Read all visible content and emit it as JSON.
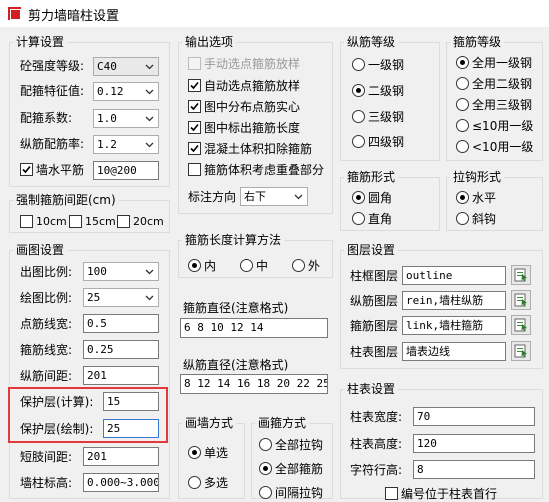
{
  "window": {
    "title": "剪力墙暗柱设置"
  },
  "calc": {
    "legend": "计算设置",
    "concrete_label": "砼强度等级:",
    "concrete_value": "C40",
    "stirrup_char_label": "配箍特征值:",
    "stirrup_char_value": "0.12",
    "stirrup_coef_label": "配箍系数:",
    "stirrup_coef_value": "1.0",
    "longit_ratio_label": "纵筋配筋率:",
    "longit_ratio_value": "1.2",
    "wall_hrebar_label": "墙水平筋",
    "wall_hrebar_value": "10@200",
    "wall_hrebar_checked": true
  },
  "forced_spacing": {
    "legend": "强制箍筋间距(cm)",
    "options": [
      {
        "label": "10cm",
        "checked": false
      },
      {
        "label": "15cm",
        "checked": false
      },
      {
        "label": "20cm",
        "checked": false
      }
    ]
  },
  "draw": {
    "legend": "画图设置",
    "scale_label": "出图比例:",
    "scale_value": "100",
    "drawscale_label": "绘图比例:",
    "drawscale_value": "25",
    "dotlinewidth_label": "点筋线宽:",
    "dotlinewidth_value": "0.5",
    "stirruplinewidth_label": "箍筋线宽:",
    "stirruplinewidth_value": "0.25",
    "longspacing_label": "纵筋间距:",
    "longspacing_value": "201",
    "cover_calc_label": "保护层(计算):",
    "cover_calc_value": "15",
    "cover_draw_label": "保护层(绘制):",
    "cover_draw_value": "25",
    "shortleg_label": "短肢间距:",
    "shortleg_value": "201",
    "elev_label": "墙柱标高:",
    "elev_value": "0.000~3.000",
    "highlight_color": "#e23a3a"
  },
  "output": {
    "legend": "输出选项",
    "items": [
      {
        "label": "手动选点箍筋放样",
        "checked": false,
        "disabled": true
      },
      {
        "label": "自动选点箍筋放样",
        "checked": true,
        "disabled": false
      },
      {
        "label": "图中分布点筋实心",
        "checked": true,
        "disabled": false
      },
      {
        "label": "图中标出箍筋长度",
        "checked": true,
        "disabled": false
      },
      {
        "label": "混凝土体积扣除箍筋",
        "checked": true,
        "disabled": false
      },
      {
        "label": "箍筋体积考虑重叠部分",
        "checked": false,
        "disabled": false
      }
    ],
    "label_dir_label": "标注方向",
    "label_dir_value": "右下"
  },
  "rebar_grade": {
    "legend": "纵筋等级",
    "options": [
      {
        "label": "一级钢",
        "selected": false
      },
      {
        "label": "二级钢",
        "selected": true
      },
      {
        "label": "三级钢",
        "selected": false
      },
      {
        "label": "四级钢",
        "selected": false
      }
    ]
  },
  "stirrup_grade": {
    "legend": "箍筋等级",
    "options": [
      {
        "label": "全用一级钢",
        "selected": true
      },
      {
        "label": "全用二级钢",
        "selected": false
      },
      {
        "label": "全用三级钢",
        "selected": false
      },
      {
        "label": "≤10用一级",
        "selected": false
      },
      {
        "label": "<10用一级",
        "selected": false
      }
    ]
  },
  "stirrup_shape": {
    "legend": "箍筋形式",
    "options": [
      {
        "label": "圆角",
        "selected": true
      },
      {
        "label": "直角",
        "selected": false
      }
    ]
  },
  "hook_shape": {
    "legend": "拉钩形式",
    "options": [
      {
        "label": "水平",
        "selected": true
      },
      {
        "label": "斜钩",
        "selected": false
      }
    ]
  },
  "stirrup_length": {
    "legend": "箍筋长度计算方法",
    "options": [
      {
        "label": "内",
        "selected": true
      },
      {
        "label": "中",
        "selected": false
      },
      {
        "label": "外",
        "selected": false
      }
    ]
  },
  "stirrup_dia": {
    "label": "箍筋直径(注意格式)",
    "value": "6 8 10 12 14"
  },
  "longit_dia": {
    "label": "纵筋直径(注意格式)",
    "value": "8 12 14 16 18 20 22 25 2"
  },
  "layers": {
    "legend": "图层设置",
    "items": [
      {
        "label": "柱框图层",
        "value": "outline"
      },
      {
        "label": "纵筋图层",
        "value": "rein,墙柱纵筋"
      },
      {
        "label": "箍筋图层",
        "value": "link,墙柱箍筋"
      },
      {
        "label": "柱表图层",
        "value": "墙表边线"
      }
    ]
  },
  "wall_method": {
    "legend": "画墙方式",
    "options": [
      {
        "label": "单选",
        "selected": true
      },
      {
        "label": "多选",
        "selected": false
      }
    ]
  },
  "stirrup_method": {
    "legend": "画箍方式",
    "options": [
      {
        "label": "全部拉钩",
        "selected": false
      },
      {
        "label": "全部箍筋",
        "selected": true
      },
      {
        "label": "间隔拉钩",
        "selected": false
      }
    ]
  },
  "table": {
    "legend": "柱表设置",
    "width_label": "柱表宽度:",
    "width_value": "70",
    "height_label": "柱表高度:",
    "height_value": "120",
    "char_label": "字符行高:",
    "char_value": "8",
    "num_top_label": "编号位于柱表首行",
    "num_top_checked": false
  }
}
